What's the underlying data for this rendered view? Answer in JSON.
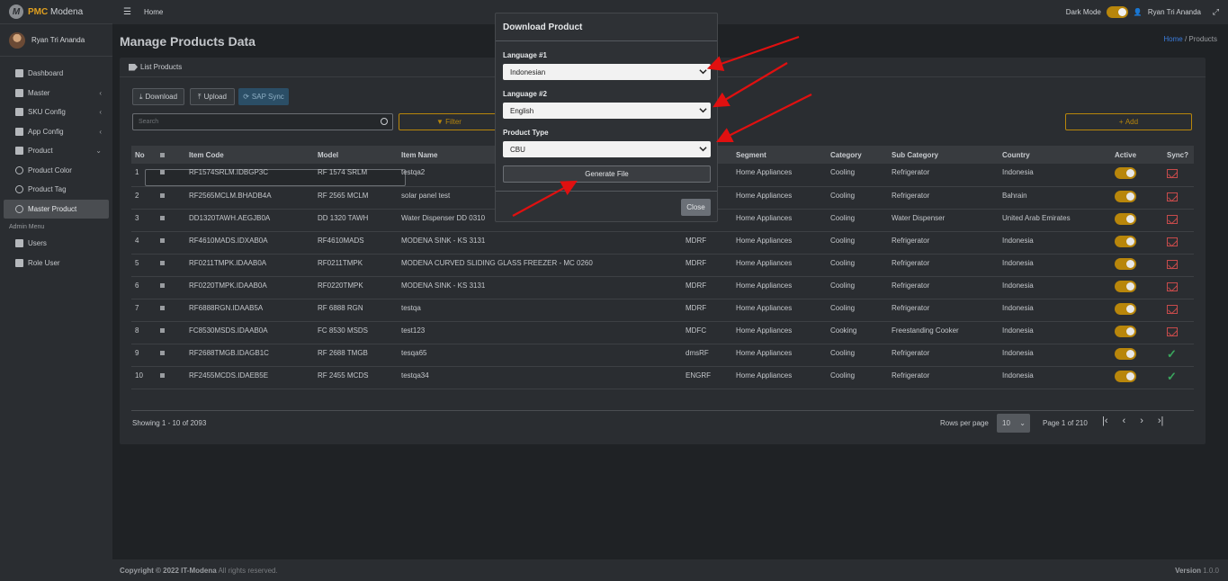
{
  "brand": {
    "prefix": "PMC",
    "name": "Modena",
    "logo_letter": "M"
  },
  "sidebar": {
    "user_name": "Ryan Tri Ananda",
    "items": [
      {
        "label": "Dashboard",
        "icon": "grid-icon",
        "chevron": false
      },
      {
        "label": "Master",
        "icon": "car-icon",
        "chevron": true
      },
      {
        "label": "SKU Config",
        "icon": "gear-icon",
        "chevron": true
      },
      {
        "label": "App Config",
        "icon": "gear-icon",
        "chevron": true
      },
      {
        "label": "Product",
        "icon": "car-icon",
        "chevron": true
      },
      {
        "label": "Product Color",
        "icon": "circle-icon",
        "chevron": false
      },
      {
        "label": "Product Tag",
        "icon": "circle-icon",
        "chevron": false
      },
      {
        "label": "Master Product",
        "icon": "circle-icon",
        "chevron": false
      }
    ],
    "admin_header": "Admin Menu",
    "admin_items": [
      {
        "label": "Users",
        "icon": "users-icon"
      },
      {
        "label": "Role User",
        "icon": "lock-icon"
      }
    ]
  },
  "topbar": {
    "home": "Home",
    "dark_mode": "Dark Mode",
    "user": "Ryan Tri Ananda"
  },
  "page": {
    "title": "Manage Products Data",
    "crumb_home": "Home",
    "crumb_sep": "/",
    "crumb_current": "Products"
  },
  "card": {
    "title": "List Products",
    "download": "Download",
    "upload": "Upload",
    "sap_sync": "SAP Sync",
    "search_placeholder": "Search",
    "filter": "Filter",
    "add": "Add"
  },
  "table": {
    "headers": [
      "No",
      "",
      "Item Code",
      "Model",
      "Item Name",
      "",
      "Segment",
      "Category",
      "Sub Category",
      "Country",
      "Active",
      "Sync?"
    ],
    "rows": [
      {
        "no": "1",
        "code": "RF1574SRLM.IDBGP3C",
        "model": "RF 1574 SRLM",
        "name": "testqa2",
        "brand": "",
        "segment": "Home Appliances",
        "category": "Cooling",
        "sub": "Refrigerator",
        "country": "Indonesia",
        "synced": false
      },
      {
        "no": "2",
        "code": "RF2565MCLM.BHADB4A",
        "model": "RF 2565 MCLM",
        "name": "solar panel test",
        "brand": "",
        "segment": "Home Appliances",
        "category": "Cooling",
        "sub": "Refrigerator",
        "country": "Bahrain",
        "synced": false
      },
      {
        "no": "3",
        "code": "DD1320TAWH.AEGJB0A",
        "model": "DD 1320 TAWH",
        "name": "Water Dispenser DD 0310",
        "brand": "",
        "segment": "Home Appliances",
        "category": "Cooling",
        "sub": "Water Dispenser",
        "country": "United Arab Emirates",
        "synced": false
      },
      {
        "no": "4",
        "code": "RF4610MADS.IDXAB0A",
        "model": "RF4610MADS",
        "name": "MODENA SINK - KS 3131",
        "brand": "MDRF",
        "segment": "Home Appliances",
        "category": "Cooling",
        "sub": "Refrigerator",
        "country": "Indonesia",
        "synced": false
      },
      {
        "no": "5",
        "code": "RF0211TMPK.IDAAB0A",
        "model": "RF0211TMPK",
        "name": "MODENA CURVED SLIDING GLASS FREEZER - MC 0260",
        "brand": "MDRF",
        "segment": "Home Appliances",
        "category": "Cooling",
        "sub": "Refrigerator",
        "country": "Indonesia",
        "synced": false
      },
      {
        "no": "6",
        "code": "RF0220TMPK.IDAAB0A",
        "model": "RF0220TMPK",
        "name": "MODENA SINK - KS 3131",
        "brand": "MDRF",
        "segment": "Home Appliances",
        "category": "Cooling",
        "sub": "Refrigerator",
        "country": "Indonesia",
        "synced": false
      },
      {
        "no": "7",
        "code": "RF6888RGN.IDAAB5A",
        "model": "RF 6888 RGN",
        "name": "testqa",
        "brand": "MDRF",
        "segment": "Home Appliances",
        "category": "Cooling",
        "sub": "Refrigerator",
        "country": "Indonesia",
        "synced": false
      },
      {
        "no": "8",
        "code": "FC8530MSDS.IDAAB0A",
        "model": "FC 8530 MSDS",
        "name": "test123",
        "brand": "MDFC",
        "segment": "Home Appliances",
        "category": "Cooking",
        "sub": "Freestanding Cooker",
        "country": "Indonesia",
        "synced": false
      },
      {
        "no": "9",
        "code": "RF2688TMGB.IDAGB1C",
        "model": "RF 2688 TMGB",
        "name": "tesqa65",
        "brand": "dmsRF",
        "segment": "Home Appliances",
        "category": "Cooling",
        "sub": "Refrigerator",
        "country": "Indonesia",
        "synced": true
      },
      {
        "no": "10",
        "code": "RF2455MCDS.IDAEB5E",
        "model": "RF 2455 MCDS",
        "name": "testqa34",
        "brand": "ENGRF",
        "segment": "Home Appliances",
        "category": "Cooling",
        "sub": "Refrigerator",
        "country": "Indonesia",
        "synced": true
      }
    ]
  },
  "pagination": {
    "showing": "Showing 1 - 10 of 2093",
    "rows_per_page": "Rows per page",
    "rows_value": "10",
    "page_of": "Page 1 of 210"
  },
  "footer": {
    "copyright_bold": "Copyright © 2022 IT-Modena",
    "copyright_rest": " All rights reserved.",
    "version_label": "Version",
    "version": "1.0.0"
  },
  "modal": {
    "title": "Download Product",
    "lang1_label": "Language #1",
    "lang1_value": "Indonesian",
    "lang2_label": "Language #2",
    "lang2_value": "English",
    "type_label": "Product Type",
    "type_value": "CBU",
    "generate": "Generate File",
    "close": "Close"
  },
  "colors": {
    "accent": "#b8860b",
    "annotation_arrow": "#e01010",
    "sync_ok": "#3aa55d",
    "sync_fail": "#c64b4b"
  }
}
